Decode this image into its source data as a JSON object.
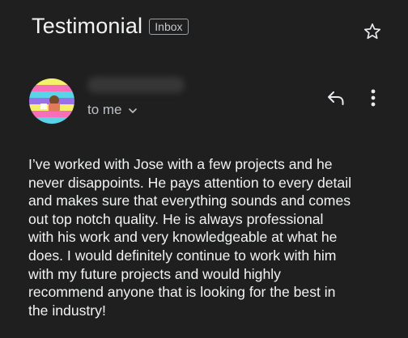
{
  "email": {
    "subject": "Testimonial",
    "label": "Inbox",
    "recipient_text": "to me",
    "body": "I’ve worked with Jose with a few projects and he\nnever disappoints. He pays attention to every detail\nand makes sure that everything sounds and comes\nout top notch quality. He is always professional\nwith his work and very knowledgeable at what he\ndoes. I would definitely continue to work with him\nwith my future projects and would highly\nrecommend anyone  that is looking for the best in\nthe industry!"
  },
  "icons": {
    "star": "star-outline-icon",
    "reply": "reply-icon",
    "more": "more-vert-icon",
    "chevron": "chevron-down-icon"
  },
  "colors": {
    "background": "#1f1f1f",
    "text_primary": "#f1f3f4",
    "text_secondary": "#bdc1c6",
    "chip_border": "#9aa0a6"
  }
}
